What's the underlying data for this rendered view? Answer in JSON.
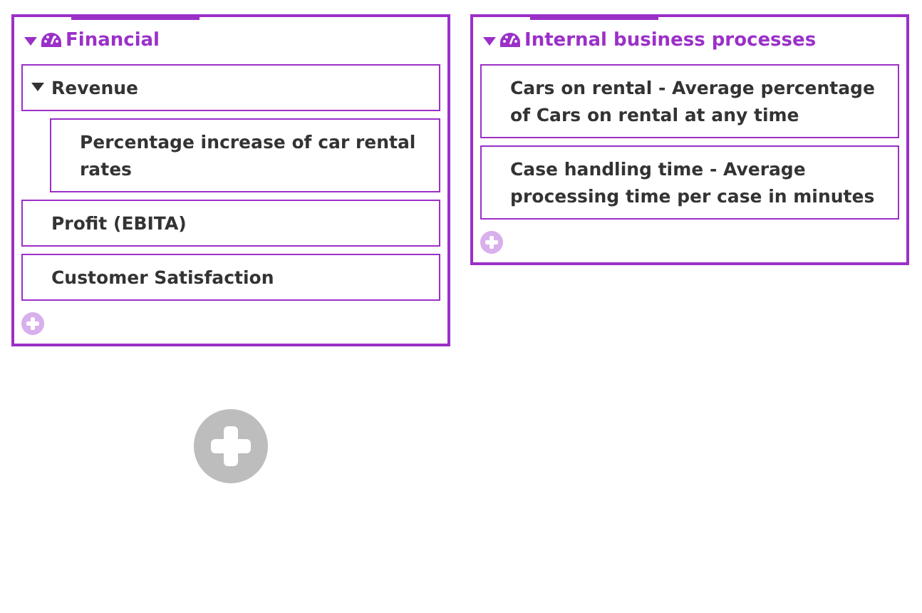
{
  "perspectives": [
    {
      "title": "Financial",
      "expanded": true,
      "items": [
        {
          "label": "Revenue",
          "expanded": true,
          "children": [
            {
              "label": "Percentage increase of car rental rates"
            }
          ]
        },
        {
          "label": "Profit (EBITA)"
        },
        {
          "label": "Customer Satisfaction"
        }
      ]
    },
    {
      "title": "Internal business processes",
      "expanded": true,
      "items": [
        {
          "label": "Cars on rental - Average percentage of Cars on rental at any time"
        },
        {
          "label": "Case handling time - Average processing time per case in minutes"
        }
      ]
    }
  ]
}
